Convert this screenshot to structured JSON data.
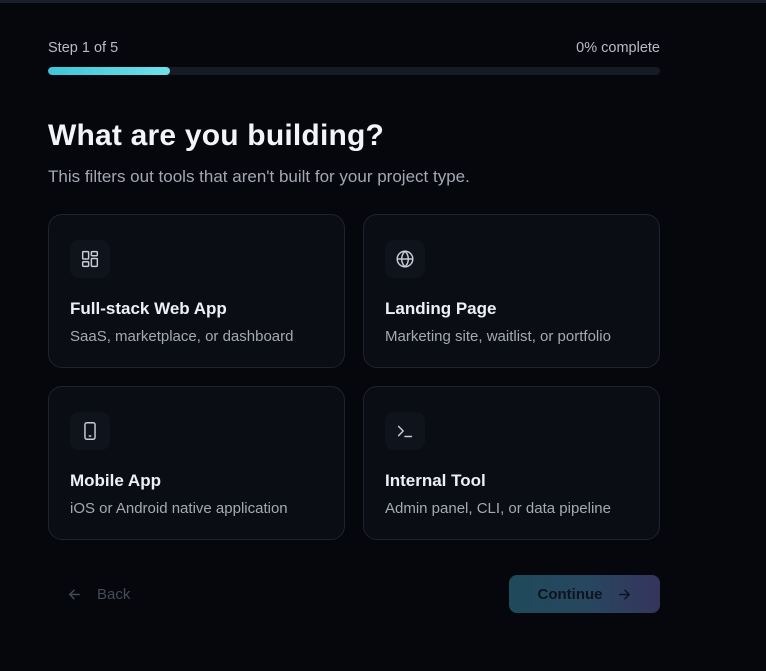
{
  "progress": {
    "step_label": "Step 1 of 5",
    "complete_label": "0% complete",
    "fill_fraction": 0.2
  },
  "heading": {
    "title": "What are you building?",
    "subtitle": "This filters out tools that aren't built for your project type."
  },
  "options": [
    {
      "icon": "grid-icon",
      "title": "Full-stack Web App",
      "description": "SaaS, marketplace, or dashboard"
    },
    {
      "icon": "globe-icon",
      "title": "Landing Page",
      "description": "Marketing site, waitlist, or portfolio"
    },
    {
      "icon": "phone-icon",
      "title": "Mobile App",
      "description": "iOS or Android native application"
    },
    {
      "icon": "terminal-icon",
      "title": "Internal Tool",
      "description": "Admin panel, CLI, or data pipeline"
    }
  ],
  "footer": {
    "back_label": "Back",
    "continue_label": "Continue"
  },
  "colors": {
    "background": "#05070c",
    "accent": "#3fc6d8",
    "card_border": "#1e2330"
  }
}
